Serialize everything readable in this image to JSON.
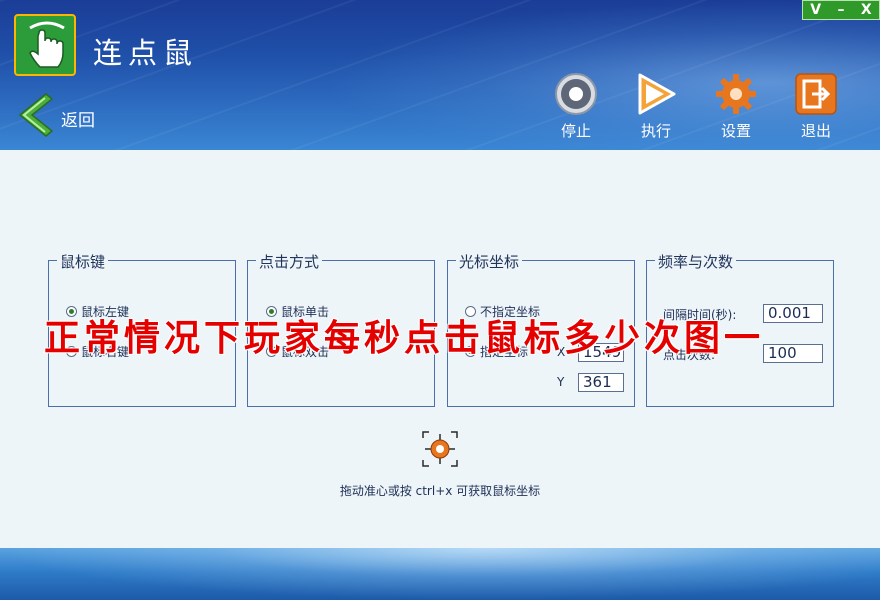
{
  "app": {
    "title": "连点鼠"
  },
  "window_controls": {
    "restore": "V",
    "minimize": "–",
    "close": "X"
  },
  "nav": {
    "back_label": "返回"
  },
  "toolbar": {
    "stop_label": "停止",
    "run_label": "执行",
    "settings_label": "设置",
    "exit_label": "退出"
  },
  "groups": {
    "mouse_button": {
      "title": "鼠标键",
      "options": [
        "鼠标左键",
        "鼠标右键"
      ],
      "selected": "鼠标左键"
    },
    "click_mode": {
      "title": "点击方式",
      "options": [
        "鼠标单击",
        "鼠标双击"
      ],
      "selected": "鼠标单击"
    },
    "cursor_coords": {
      "title": "光标坐标",
      "options": [
        "不指定坐标",
        "指定坐标"
      ],
      "selected": "指定坐标",
      "x_label": "X",
      "y_label": "Y",
      "x_value": "1549",
      "y_value": "361"
    },
    "frequency": {
      "title": "频率与次数",
      "interval_label": "间隔时间(秒):",
      "interval_value": "0.001",
      "count_label": "点击次数:",
      "count_value": "100"
    }
  },
  "hint": "拖动准心或按 ctrl+x 可获取鼠标坐标",
  "overlay_caption": "正常情况下玩家每秒点击鼠标多少次图一",
  "icons": {
    "logo": "hand-pointer-icon",
    "back": "back-arrow-icon",
    "stop": "stop-icon",
    "run": "play-icon",
    "settings": "gear-icon",
    "exit": "exit-icon",
    "crosshair": "crosshair-icon"
  },
  "colors": {
    "header_blue": "#1f4fa8",
    "logo_green": "#2c9b3a",
    "accent_orange": "#e8761e",
    "caption_red": "#e50000"
  }
}
